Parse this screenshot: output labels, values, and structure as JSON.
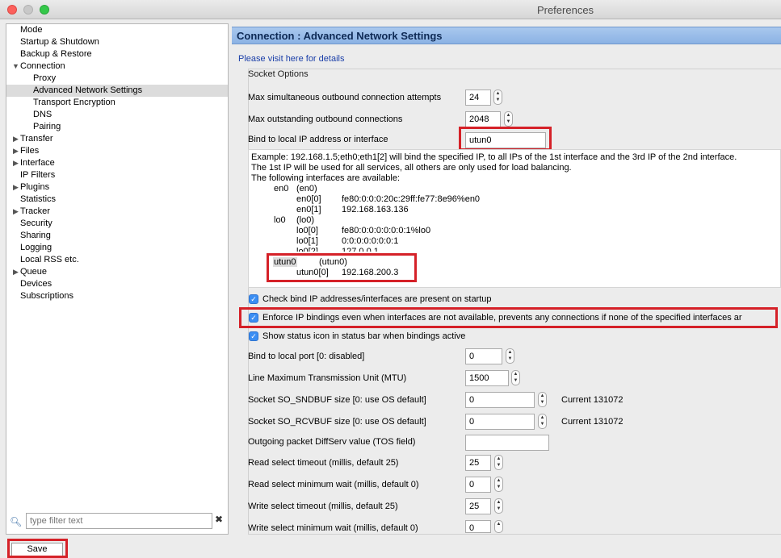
{
  "window": {
    "title": "Preferences"
  },
  "sidebar": {
    "items": [
      {
        "label": "Mode"
      },
      {
        "label": "Startup & Shutdown"
      },
      {
        "label": "Backup & Restore"
      },
      {
        "label": "Connection"
      },
      {
        "label": "Proxy"
      },
      {
        "label": "Advanced Network Settings"
      },
      {
        "label": "Transport Encryption"
      },
      {
        "label": "DNS"
      },
      {
        "label": "Pairing"
      },
      {
        "label": "Transfer"
      },
      {
        "label": "Files"
      },
      {
        "label": "Interface"
      },
      {
        "label": "IP Filters"
      },
      {
        "label": "Plugins"
      },
      {
        "label": "Statistics"
      },
      {
        "label": "Tracker"
      },
      {
        "label": "Security"
      },
      {
        "label": "Sharing"
      },
      {
        "label": "Logging"
      },
      {
        "label": "Local RSS etc."
      },
      {
        "label": "Queue"
      },
      {
        "label": "Devices"
      },
      {
        "label": "Subscriptions"
      }
    ],
    "filter_placeholder": "type filter text"
  },
  "footer": {
    "save_label": "Save"
  },
  "main": {
    "title": "Connection : Advanced Network Settings",
    "visit_link": "Please visit here for details",
    "section_title": "Socket Options",
    "max_attempts": {
      "label": "Max simultaneous outbound connection attempts",
      "value": "24"
    },
    "max_outstanding": {
      "label": "Max outstanding outbound connections",
      "value": "2048"
    },
    "bind_ip": {
      "label": "Bind to local IP address or interface",
      "value": "utun0"
    },
    "info": {
      "line1": "Example: 192.168.1.5;eth0;eth1[2] will bind the specified IP, to all IPs of the 1st interface and the 3rd IP of the 2nd interface.",
      "line2": "The 1st IP will be used for all services, all others are only used for load balancing.",
      "line3": "The following interfaces are available:",
      "interfaces": [
        {
          "name": "en0",
          "paren": "(en0)",
          "addrs": [
            {
              "idx": "en0[0]",
              "addr": "fe80:0:0:0:20c:29ff:fe77:8e96%en0"
            },
            {
              "idx": "en0[1]",
              "addr": "192.168.163.136"
            }
          ]
        },
        {
          "name": "lo0",
          "paren": "(lo0)",
          "addrs": [
            {
              "idx": "lo0[0]",
              "addr": "fe80:0:0:0:0:0:0:1%lo0"
            },
            {
              "idx": "lo0[1]",
              "addr": "0:0:0:0:0:0:0:1"
            },
            {
              "idx": "lo0[2]",
              "addr": "127.0.0.1"
            }
          ]
        },
        {
          "name": "utun0",
          "paren": "(utun0)",
          "addrs": [
            {
              "idx": "utun0[0]",
              "addr": "192.168.200.3"
            }
          ]
        }
      ]
    },
    "check_bind": {
      "label": "Check bind IP addresses/interfaces are present on startup",
      "checked": true
    },
    "enforce": {
      "label": "Enforce IP bindings even when interfaces are not available, prevents any connections if none of the specified interfaces ar",
      "checked": true
    },
    "show_status": {
      "label": "Show status icon in status bar when bindings active",
      "checked": true
    },
    "bind_port": {
      "label": "Bind to local port [0: disabled]",
      "value": "0"
    },
    "mtu": {
      "label": "Line Maximum Transmission Unit (MTU)",
      "value": "1500"
    },
    "sndbuf": {
      "label": "Socket SO_SNDBUF size [0: use OS default]",
      "value": "0",
      "current": "Current 131072"
    },
    "rcvbuf": {
      "label": "Socket SO_RCVBUF size [0: use OS default]",
      "value": "0",
      "current": "Current 131072"
    },
    "diffserv": {
      "label": "Outgoing packet DiffServ value (TOS field)",
      "value": ""
    },
    "read_timeout": {
      "label": "Read select timeout (millis, default 25)",
      "value": "25"
    },
    "read_min_wait": {
      "label": "Read select minimum wait (millis, default 0)",
      "value": "0"
    },
    "write_timeout": {
      "label": "Write select timeout (millis, default 25)",
      "value": "25"
    },
    "write_min_wait": {
      "label": "Write select minimum wait (millis, default 0)",
      "value": "0"
    }
  },
  "colors": {
    "highlight": "#d52128",
    "header": "#a9c8ee",
    "checkbox": "#3b8ef3"
  }
}
